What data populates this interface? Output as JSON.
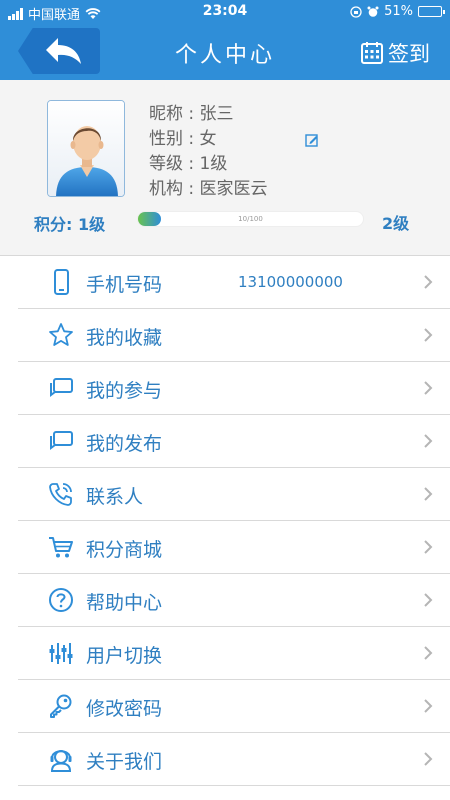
{
  "status_bar": {
    "carrier": "中国联通",
    "time": "23:04",
    "battery": "51%",
    "battery_level": 0.51
  },
  "nav": {
    "title": "个人中心",
    "signin_label": "签到"
  },
  "profile": {
    "nickname_label": "昵称",
    "nickname": "张三",
    "gender_label": "性别",
    "gender": "女",
    "level_label": "等级",
    "level": "1级",
    "org_label": "机构",
    "org": "医家医云",
    "points_label": "积分:",
    "points_level": "1级",
    "progress_text": "10/100",
    "progress_value": 0.1,
    "next_level": "2级"
  },
  "menu": [
    {
      "label": "手机号码",
      "value": "13100000000",
      "icon": "phone-icon"
    },
    {
      "label": "我的收藏",
      "icon": "star-icon"
    },
    {
      "label": "我的参与",
      "icon": "chat-icon"
    },
    {
      "label": "我的发布",
      "icon": "chat-icon"
    },
    {
      "label": "联系人",
      "icon": "phone-call-icon"
    },
    {
      "label": "积分商城",
      "icon": "cart-icon"
    },
    {
      "label": "帮助中心",
      "icon": "help-icon"
    },
    {
      "label": "用户切换",
      "icon": "switch-icon"
    },
    {
      "label": "修改密码",
      "icon": "key-icon"
    },
    {
      "label": "关于我们",
      "icon": "support-icon"
    }
  ],
  "colors": {
    "accent": "#2f8ed8",
    "text_blue": "#2f7fc1"
  }
}
